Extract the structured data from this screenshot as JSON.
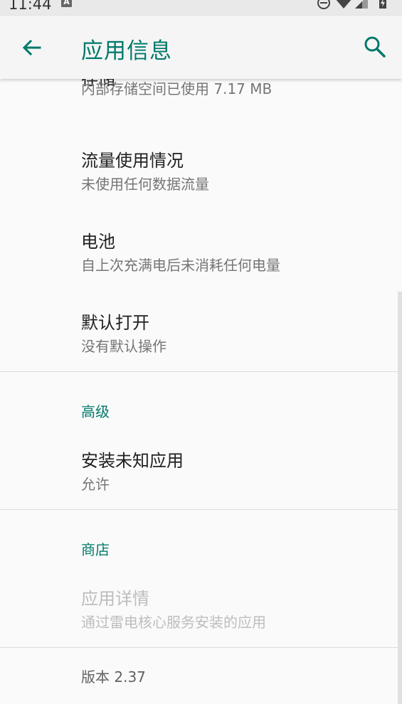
{
  "status_bar": {
    "time": "11:44",
    "notification_icon": "A"
  },
  "app_bar": {
    "title": "应用信息",
    "back_icon": "arrow-left",
    "search_icon": "search"
  },
  "items": [
    {
      "key": "storage",
      "title": "存储",
      "subtitle": "内部存储空间已使用 7.17 MB"
    },
    {
      "key": "data",
      "title": "流量使用情况",
      "subtitle": "未使用任何数据流量"
    },
    {
      "key": "battery",
      "title": "电池",
      "subtitle": "自上次充满电后未消耗任何电量"
    },
    {
      "key": "open_default",
      "title": "默认打开",
      "subtitle": "没有默认操作"
    }
  ],
  "advanced": {
    "header": "高级",
    "install_unknown": {
      "title": "安装未知应用",
      "subtitle": "允许"
    }
  },
  "store": {
    "header": "商店",
    "app_details": {
      "title": "应用详情",
      "subtitle": "通过雷电核心服务安装的应用"
    }
  },
  "version": "版本 2.37",
  "colors": {
    "accent": "#00796b",
    "title_text": "#212121",
    "subtitle_text": "#757575",
    "disabled_text": "#bdbdbd"
  }
}
